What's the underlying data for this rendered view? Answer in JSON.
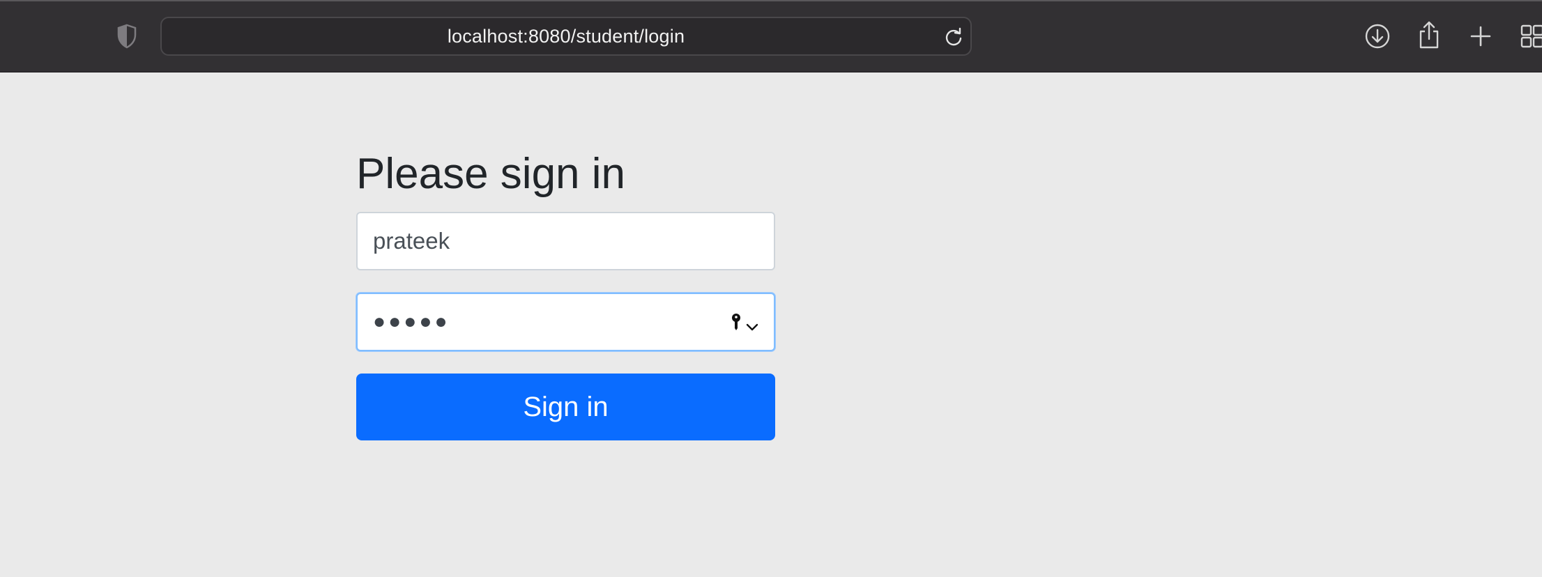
{
  "browser": {
    "url": "localhost:8080/student/login",
    "icons": [
      "shield-icon",
      "reload-icon",
      "download-icon",
      "share-icon",
      "plus-icon",
      "tab-overview-icon"
    ]
  },
  "login": {
    "heading": "Please sign in",
    "username_value": "prateek",
    "password_masked": "●●●●●",
    "submit_label": "Sign in",
    "icons": [
      "key-icon",
      "chevron-down-icon"
    ]
  },
  "colors": {
    "toolbar_bg": "#323033",
    "page_bg": "#eaeaea",
    "button_bg": "#0a6cff",
    "focus_border": "#80bdff"
  }
}
